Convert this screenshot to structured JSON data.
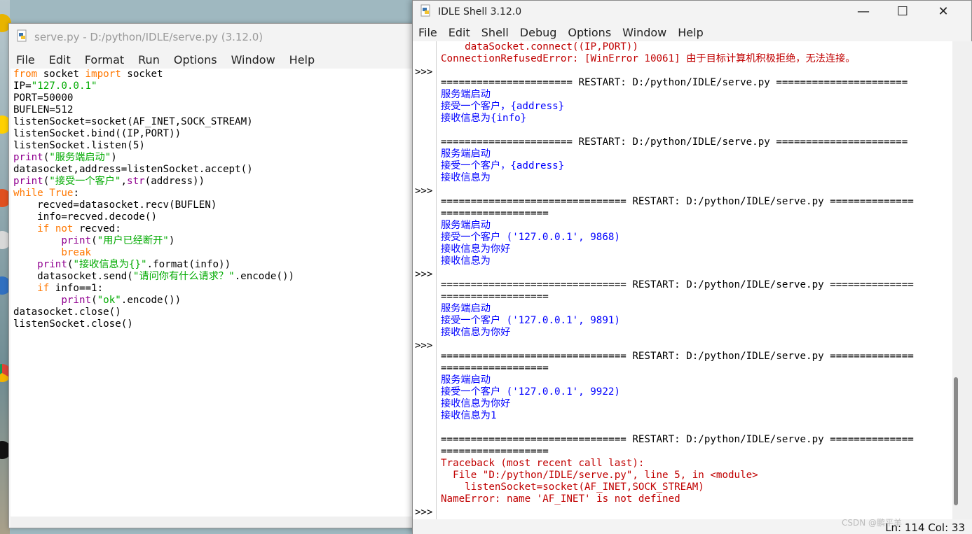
{
  "editor": {
    "title": "serve.py - D:/python/IDLE/serve.py (3.12.0)",
    "menu": [
      "File",
      "Edit",
      "Format",
      "Run",
      "Options",
      "Window",
      "Help"
    ],
    "code": [
      [
        {
          "t": "from",
          "c": "kw"
        },
        {
          "t": " socket "
        },
        {
          "t": "import",
          "c": "kw"
        },
        {
          "t": " socket"
        }
      ],
      [
        {
          "t": "IP="
        },
        {
          "t": "\"127.0.0.1\"",
          "c": "str"
        }
      ],
      [
        {
          "t": "PORT=50000"
        }
      ],
      [
        {
          "t": "BUFLEN=512"
        }
      ],
      [
        {
          "t": "listenSocket=socket(AF_INET,SOCK_STREAM)"
        }
      ],
      [
        {
          "t": "listenSocket.bind((IP,PORT))"
        }
      ],
      [
        {
          "t": "listenSocket.listen(5)"
        }
      ],
      [
        {
          "t": "print",
          "c": "bi"
        },
        {
          "t": "("
        },
        {
          "t": "\"服务端启动\"",
          "c": "str"
        },
        {
          "t": ")"
        }
      ],
      [
        {
          "t": "datasocket,address=listenSocket.accept()"
        }
      ],
      [
        {
          "t": "print",
          "c": "bi"
        },
        {
          "t": "("
        },
        {
          "t": "\"接受一个客户\"",
          "c": "str"
        },
        {
          "t": ","
        },
        {
          "t": "str",
          "c": "bi"
        },
        {
          "t": "(address))"
        }
      ],
      [
        {
          "t": "while",
          "c": "kw"
        },
        {
          "t": " "
        },
        {
          "t": "True",
          "c": "kw"
        },
        {
          "t": ":"
        }
      ],
      [
        {
          "t": "    recved=datasocket.recv(BUFLEN)"
        }
      ],
      [
        {
          "t": "    info=recved.decode()"
        }
      ],
      [
        {
          "t": "    "
        },
        {
          "t": "if",
          "c": "kw"
        },
        {
          "t": " "
        },
        {
          "t": "not",
          "c": "kw"
        },
        {
          "t": " recved:"
        }
      ],
      [
        {
          "t": "        "
        },
        {
          "t": "print",
          "c": "bi"
        },
        {
          "t": "("
        },
        {
          "t": "\"用户已经断开\"",
          "c": "str"
        },
        {
          "t": ")"
        }
      ],
      [
        {
          "t": "        "
        },
        {
          "t": "break",
          "c": "kw"
        }
      ],
      [
        {
          "t": "    "
        },
        {
          "t": "print",
          "c": "bi"
        },
        {
          "t": "("
        },
        {
          "t": "\"接收信息为{}\"",
          "c": "str"
        },
        {
          "t": ".format(info))"
        }
      ],
      [
        {
          "t": "    datasocket.send("
        },
        {
          "t": "\"请问你有什么请求？\"",
          "c": "str"
        },
        {
          "t": ".encode())"
        }
      ],
      [
        {
          "t": "    "
        },
        {
          "t": "if",
          "c": "kw"
        },
        {
          "t": " info==1:"
        }
      ],
      [
        {
          "t": "        "
        },
        {
          "t": "print",
          "c": "bi"
        },
        {
          "t": "("
        },
        {
          "t": "\"ok\"",
          "c": "str"
        },
        {
          "t": ".encode())"
        }
      ],
      [
        {
          "t": "datasocket.close()"
        }
      ],
      [
        {
          "t": "listenSocket.close()"
        }
      ]
    ]
  },
  "shell": {
    "title": "IDLE Shell 3.12.0",
    "menu": [
      "File",
      "Edit",
      "Shell",
      "Debug",
      "Options",
      "Window",
      "Help"
    ],
    "controls": {
      "minimize": "—",
      "maximize": "☐",
      "close": "✕"
    },
    "prompt": ">>>",
    "lines": [
      {
        "t": "    dataSocket.connect((IP,PORT))",
        "c": "err"
      },
      {
        "t": "ConnectionRefusedError: [WinError 10061] 由于目标计算机积极拒绝，无法连接。",
        "c": "err"
      },
      {
        "t": "",
        "p": true
      },
      {
        "t": "====================== RESTART: D:/python/IDLE/serve.py ======================",
        "c": "sep"
      },
      {
        "t": "服务端启动",
        "c": "outb"
      },
      {
        "t": "接受一个客户，{address}",
        "c": "outb"
      },
      {
        "t": "接收信息为{info}",
        "c": "outb"
      },
      {
        "t": ""
      },
      {
        "t": "====================== RESTART: D:/python/IDLE/serve.py ======================",
        "c": "sep"
      },
      {
        "t": "服务端启动",
        "c": "outb"
      },
      {
        "t": "接受一个客户，{address}",
        "c": "outb"
      },
      {
        "t": "接收信息为",
        "c": "outb"
      },
      {
        "t": "",
        "p": true
      },
      {
        "t": "=============================== RESTART: D:/python/IDLE/serve.py ==============",
        "c": "sep"
      },
      {
        "t": "==================",
        "c": "sep"
      },
      {
        "t": "服务端启动",
        "c": "outb"
      },
      {
        "t": "接受一个客户 ('127.0.0.1', 9868)",
        "c": "outb"
      },
      {
        "t": "接收信息为你好",
        "c": "outb"
      },
      {
        "t": "接收信息为",
        "c": "outb"
      },
      {
        "t": "",
        "p": true
      },
      {
        "t": "=============================== RESTART: D:/python/IDLE/serve.py ==============",
        "c": "sep"
      },
      {
        "t": "==================",
        "c": "sep"
      },
      {
        "t": "服务端启动",
        "c": "outb"
      },
      {
        "t": "接受一个客户 ('127.0.0.1', 9891)",
        "c": "outb"
      },
      {
        "t": "接收信息为你好",
        "c": "outb"
      },
      {
        "t": "",
        "p": true
      },
      {
        "t": "=============================== RESTART: D:/python/IDLE/serve.py ==============",
        "c": "sep"
      },
      {
        "t": "==================",
        "c": "sep"
      },
      {
        "t": "服务端启动",
        "c": "outb"
      },
      {
        "t": "接受一个客户 ('127.0.0.1', 9922)",
        "c": "outb"
      },
      {
        "t": "接收信息为你好",
        "c": "outb"
      },
      {
        "t": "接收信息为1",
        "c": "outb"
      },
      {
        "t": ""
      },
      {
        "t": "=============================== RESTART: D:/python/IDLE/serve.py ==============",
        "c": "sep"
      },
      {
        "t": "==================",
        "c": "sep"
      },
      {
        "t": "Traceback (most recent call last):",
        "c": "err"
      },
      {
        "t": "  File \"D:/python/IDLE/serve.py\", line 5, in <module>",
        "c": "err"
      },
      {
        "t": "    listenSocket=socket(AF_INET,SOCK_STREAM)",
        "c": "err"
      },
      {
        "t": "NameError: name 'AF_INET' is not defined",
        "c": "err"
      },
      {
        "t": "",
        "p": true
      }
    ],
    "status": "Ln: 114   Col: 33"
  },
  "watermark": "CSDN @鹏平羊"
}
